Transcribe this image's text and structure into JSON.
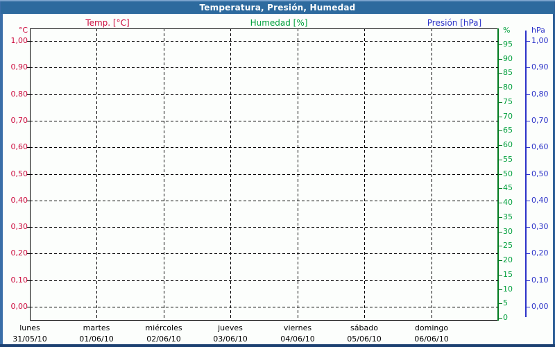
{
  "titlebar": {
    "title": "Temperatura, Presión, Humedad"
  },
  "legend": {
    "items": [
      {
        "label": "Temp. [°C]",
        "color": "#cc0a3c"
      },
      {
        "label": "Humedad [%]",
        "color": "#00a03c"
      },
      {
        "label": "Presión [hPa]",
        "color": "#2b32c8"
      }
    ]
  },
  "chart_data": {
    "type": "line",
    "title": "Temperatura, Presión, Humedad",
    "grid": true,
    "legend_position": "top",
    "note": "empty chart grid - no data points plotted",
    "series": [
      {
        "name": "Temp. [°C]",
        "axis": "temperature",
        "color": "#cc0a3c",
        "values": []
      },
      {
        "name": "Humedad [%]",
        "axis": "humidity",
        "color": "#00a03c",
        "values": []
      },
      {
        "name": "Presión [hPa]",
        "axis": "pressure",
        "color": "#2b32c8",
        "values": []
      }
    ],
    "axes": {
      "temperature": {
        "side": "left",
        "unit_label": "°C",
        "color": "#cc0a3c",
        "min": 0,
        "max": 1,
        "tick_labels": [
          "1,00",
          "0,90",
          "0,80",
          "0,70",
          "0,60",
          "0,50",
          "0,40",
          "0,30",
          "0,20",
          "0,10",
          "0,00"
        ]
      },
      "humidity": {
        "side": "right-inner",
        "unit_label": "%",
        "color": "#00a03c",
        "line_color": "#007a1e",
        "min": 0,
        "max": 100,
        "tick_labels": [
          "95",
          "90",
          "85",
          "80",
          "75",
          "70",
          "65",
          "60",
          "55",
          "50",
          "45",
          "40",
          "35",
          "30",
          "25",
          "20",
          "15",
          "10",
          "5",
          "0"
        ]
      },
      "pressure": {
        "side": "right-outer",
        "unit_label": "hPa",
        "color": "#2b32c8",
        "min": 0,
        "max": 1,
        "tick_labels": [
          "1,00",
          "0,90",
          "0,80",
          "0,70",
          "0,60",
          "0,50",
          "0,40",
          "0,30",
          "0,20",
          "0,10",
          "0,00"
        ]
      },
      "x": {
        "days": [
          {
            "day": "lunes",
            "date": "31/05/10"
          },
          {
            "day": "martes",
            "date": "01/06/10"
          },
          {
            "day": "miércoles",
            "date": "02/06/10"
          },
          {
            "day": "jueves",
            "date": "03/06/10"
          },
          {
            "day": "viernes",
            "date": "04/06/10"
          },
          {
            "day": "sábado",
            "date": "05/06/10"
          },
          {
            "day": "domingo",
            "date": "06/06/10"
          }
        ]
      }
    }
  },
  "colors": {
    "titlebar_bg": "#2d6a9e",
    "titlebar_text": "#ffffff",
    "frame_side": "#3a6ea8",
    "frame_bottom": "#1c4071",
    "plot_border": "#000000",
    "background": "#fcfefc"
  }
}
